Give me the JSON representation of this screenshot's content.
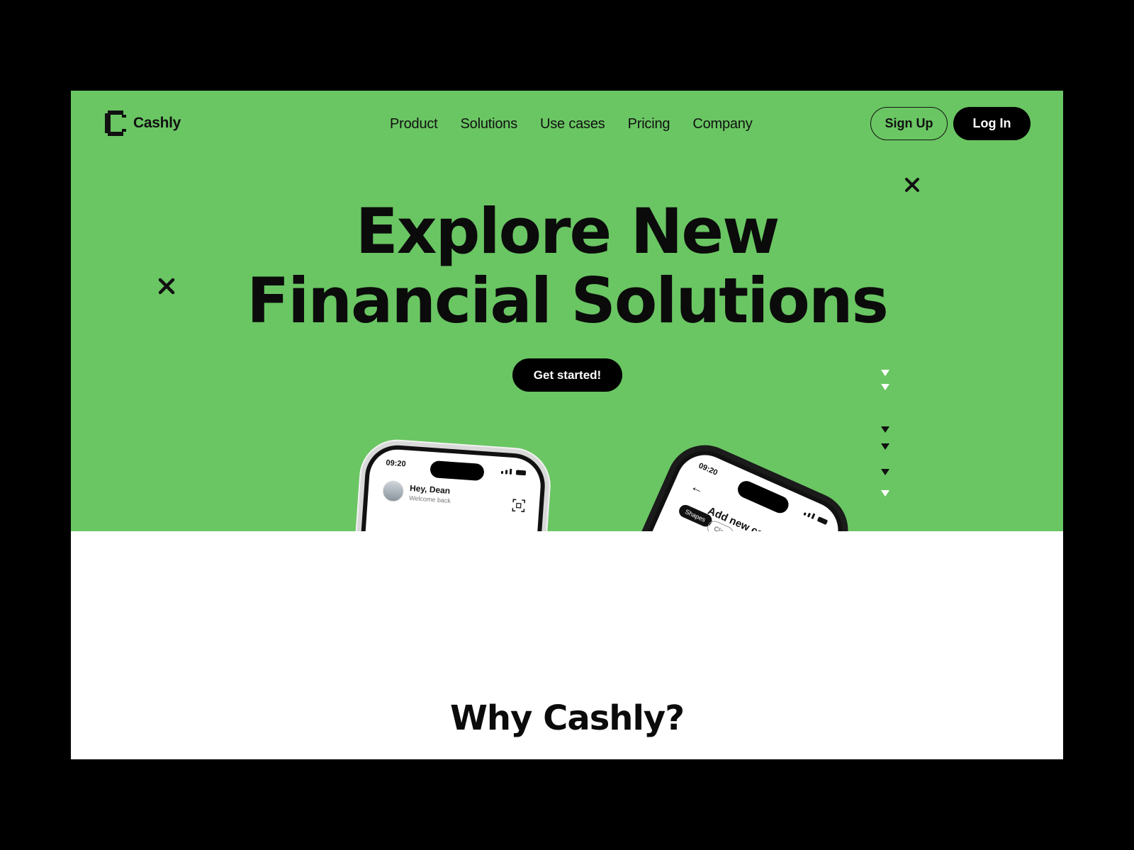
{
  "brand": {
    "name": "Cashly"
  },
  "nav": {
    "items": [
      {
        "label": "Product"
      },
      {
        "label": "Solutions"
      },
      {
        "label": "Use cases"
      },
      {
        "label": "Pricing"
      },
      {
        "label": "Company"
      }
    ],
    "signup_label": "Sign Up",
    "login_label": "Log In"
  },
  "hero": {
    "headline_line1": "Explore New",
    "headline_line2": "Financial Solutions",
    "cta_label": "Get started!"
  },
  "phone_left": {
    "time": "09:20",
    "greeting": "Hey, Dean",
    "subtitle": "Welcome back"
  },
  "phone_right": {
    "time": "09:20",
    "title": "Add new card",
    "chip_active": "Shapes",
    "chip_idle": "Clas"
  },
  "why": {
    "title": "Why Cashly?"
  },
  "colors": {
    "hero_bg": "#6ac663",
    "frame_bg": "#000000",
    "text": "#0b0b0b",
    "button_dark": "#000000"
  }
}
